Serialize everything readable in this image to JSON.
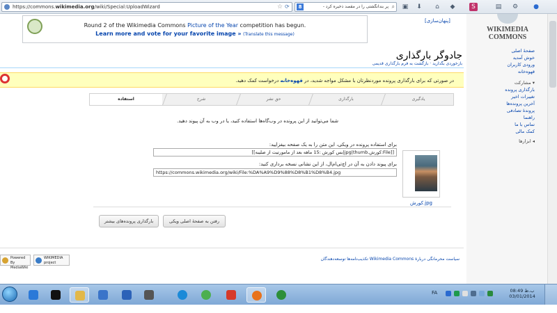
{
  "browser": {
    "url_prefix": "https://commons.",
    "url_domain": "wikimedia.org",
    "url_path": "/wiki/Special:UploadWizard",
    "search_text": "پر بندانگشتی را در مقصد ذخیره کرد - "
  },
  "banner": {
    "line1_pre": "Round 2 of the Wikimedia Commons ",
    "line1_link": "Picture of the Year",
    "line1_post": " competition has begun.",
    "line2": "Learn more and vote for your favorite image »",
    "translate": "(Translate this message)",
    "hide": "[پنهان‌سازی]"
  },
  "logo": {
    "line1": "WIKIMEDIA",
    "line2": "COMMONS"
  },
  "sidebar": {
    "items": [
      "صفحهٔ اصلی",
      "خوش آمدید",
      "ورودی کاربران",
      "قهوه‌خانه"
    ],
    "participate_heading": "مشارکت",
    "participate": [
      "بارگذاری پرونده",
      "تغییرات اخیر",
      "آخرین پرونده‌ها",
      "پروندهٔ تصادفی",
      "راهنما",
      "تماس با ما",
      "کمک مالی"
    ],
    "tools": "ابزارها"
  },
  "header": {
    "title": "جادوگر بارگذاری",
    "subnav": "بازخوردی بگذارید · بازگشت به فرم بارگذاری قدیمی"
  },
  "notice": {
    "pre": "در صورتی که برای بارگذاری پرونده موردنظرتان با مشکل مواجه شدید، در ",
    "link": "قهوه‌خانه",
    "post": " درخواست کمک دهید."
  },
  "steps": [
    "یادگیری",
    "بارگذاری",
    "حق نشر",
    "شرح",
    "استفاده"
  ],
  "main": {
    "message": "شما می‌توانید از این پرونده در وب‌گاه‌ها استفاده کنید، یا در وب به آن پیوند دهید.",
    "wiki_label": "برای استفاده پرونده در ویکی، این متن را به یک صفحه بیفزایید:",
    "wiki_value": "[[File:کورش.jpg|thumb|بس کورش :15 ماهه بعد از مامورتیت از صلیبه]]",
    "link_label": "برای پیوند دادن به آن در اچ‌تی‌ام‌ال، از این نشانی نسخه برداری کنید:",
    "link_value": "https://commons.wikimedia.org/wiki/File:%DA%A9%D9%88%D8%B1%D8%B4.jpg",
    "thumb_caption": "کورش.jpg"
  },
  "buttons": {
    "home": "رفتن به صفحهٔ اصلی ویکی",
    "more": "بارگذاری پرونده‌های بیشتر"
  },
  "footer": {
    "links": "سیاست محرمانگی   دربارهٔ Wikimedia Commons   تکذیب‌نامه‌ها   توسعه‌دهندگان",
    "badge1": "Powered By MediaWiki",
    "badge2": "WIKIMEDIA project"
  },
  "taskbar": {
    "lang": "FA",
    "time": "08:49 ب.ظ",
    "date": "03/01/2014"
  }
}
